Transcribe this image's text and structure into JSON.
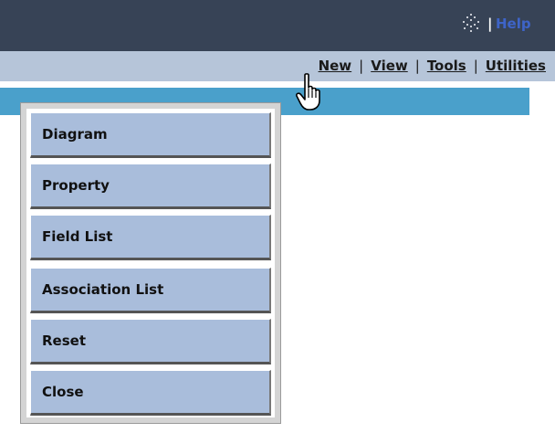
{
  "topbar": {
    "separator": "|",
    "help_label": "Help",
    "sparkle_icon": "sparkle-icon"
  },
  "menubar": {
    "items": [
      {
        "label": "New"
      },
      {
        "label": "View"
      },
      {
        "label": "Tools"
      },
      {
        "label": "Utilities"
      }
    ],
    "separator": "|"
  },
  "dropdown": {
    "parent_menu": "View",
    "items": [
      {
        "label": "Diagram"
      },
      {
        "label": "Property"
      },
      {
        "label": "Field List"
      },
      {
        "label": "Association List"
      },
      {
        "label": "Reset"
      },
      {
        "label": "Close"
      }
    ]
  },
  "cursor": "hand-pointer-icon",
  "colors": {
    "topbar_bg": "#374356",
    "menubar_bg": "#b6c5d9",
    "band_bg": "#4aa0cb",
    "item_bg": "#a9bddb",
    "help_link": "#3e64c8"
  }
}
